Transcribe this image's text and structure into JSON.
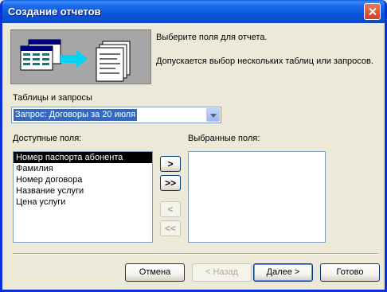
{
  "window": {
    "title": "Создание отчетов"
  },
  "intro": {
    "line1": "Выберите поля для отчета.",
    "line2": "Допускается выбор нескольких таблиц или запросов."
  },
  "tables": {
    "label": "Таблицы и запросы",
    "selected_value": "Запрос: Договоры за 20 июля"
  },
  "available": {
    "label": "Доступные поля:",
    "items": [
      "Номер паспорта абонента",
      "Фамилия",
      "Номер договора",
      "Название услуги",
      "Цена услуги"
    ],
    "selected_index": 0
  },
  "selected": {
    "label": "Выбранные поля:",
    "items": []
  },
  "move_buttons": {
    "add": ">",
    "add_all": ">>",
    "remove": "<",
    "remove_all": "<<"
  },
  "nav": {
    "cancel": "Отмена",
    "back": "< Назад",
    "next": "Далее >",
    "finish": "Готово"
  },
  "colors": {
    "titlebar": "#0A4FD0",
    "face": "#ECE9D8",
    "selection": "#316AC5"
  }
}
